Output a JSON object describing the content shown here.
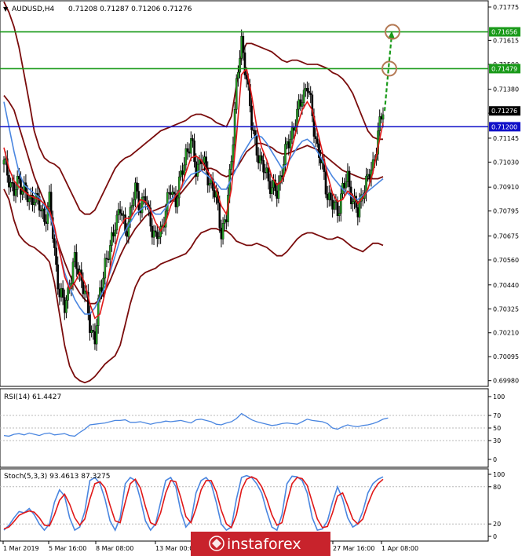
{
  "header": {
    "symbol": "AUDUSD,H4",
    "ohlc": "0.71208 0.71287 0.71206 0.71276"
  },
  "chart_data": [
    {
      "type": "candlestick",
      "ylim": [
        0.6996,
        0.7179
      ],
      "y_ticks": [
        "0.71775",
        "0.71615",
        "0.71500",
        "0.71380",
        "0.71265",
        "0.71145",
        "0.71030",
        "0.70910",
        "0.70795",
        "0.70675",
        "0.70560",
        "0.70440",
        "0.70325",
        "0.70210",
        "0.70095",
        "0.69980"
      ],
      "price_tags": [
        {
          "value": 0.71656,
          "label": "0.71656",
          "color": "#1a9a1a"
        },
        {
          "value": 0.71479,
          "label": "0.71479",
          "color": "#1a9a1a"
        },
        {
          "value": 0.71276,
          "label": "0.71276",
          "color": "#000000"
        },
        {
          "value": 0.712,
          "label": "0.71200",
          "color": "#1010c8"
        }
      ],
      "levels": [
        {
          "value": 0.71656,
          "color": "#1a9a1a"
        },
        {
          "value": 0.71479,
          "color": "#1a9a1a"
        },
        {
          "value": 0.712,
          "color": "#1010c8"
        }
      ],
      "close_path": [
        0.7102,
        0.7096,
        0.7088,
        0.7094,
        0.709,
        0.7083,
        0.7088,
        0.7081,
        0.7076,
        0.7084,
        0.706,
        0.704,
        0.7033,
        0.7045,
        0.7055,
        0.705,
        0.704,
        0.7025,
        0.7018,
        0.704,
        0.7055,
        0.706,
        0.7075,
        0.708,
        0.707,
        0.7078,
        0.709,
        0.7082,
        0.7085,
        0.7075,
        0.7065,
        0.707,
        0.708,
        0.709,
        0.7085,
        0.7095,
        0.7108,
        0.7112,
        0.71,
        0.7105,
        0.7098,
        0.7093,
        0.7085,
        0.707,
        0.7076,
        0.7105,
        0.714,
        0.716,
        0.7145,
        0.712,
        0.711,
        0.71,
        0.7098,
        0.709,
        0.7088,
        0.71,
        0.711,
        0.7118,
        0.7125,
        0.7135,
        0.714,
        0.7125,
        0.711,
        0.71,
        0.7088,
        0.7082,
        0.708,
        0.709,
        0.7095,
        0.7085,
        0.7078,
        0.709,
        0.7094,
        0.7102,
        0.7116,
        0.7128
      ],
      "ma_blue": [
        0.7132,
        0.712,
        0.7108,
        0.7098,
        0.7092,
        0.709,
        0.7088,
        0.7086,
        0.7082,
        0.7078,
        0.707,
        0.706,
        0.705,
        0.7043,
        0.7037,
        0.7033,
        0.703,
        0.703,
        0.7033,
        0.7038,
        0.7043,
        0.705,
        0.7058,
        0.7066,
        0.707,
        0.7074,
        0.7078,
        0.708,
        0.7082,
        0.708,
        0.7078,
        0.7078,
        0.7081,
        0.7085,
        0.7087,
        0.709,
        0.7094,
        0.7097,
        0.7098,
        0.7099,
        0.7097,
        0.7095,
        0.7093,
        0.709,
        0.709,
        0.7095,
        0.71,
        0.7106,
        0.711,
        0.7114,
        0.7116,
        0.7115,
        0.7112,
        0.7108,
        0.7104,
        0.71,
        0.7102,
        0.7106,
        0.711,
        0.7113,
        0.7114,
        0.7112,
        0.7108,
        0.7104,
        0.71,
        0.7096,
        0.7093,
        0.709,
        0.7088,
        0.7086,
        0.7085,
        0.7087,
        0.7089,
        0.7091,
        0.7093,
        0.7095
      ],
      "ma_red": [
        0.711,
        0.71,
        0.7094,
        0.7091,
        0.7089,
        0.7087,
        0.7086,
        0.7085,
        0.7083,
        0.708,
        0.7072,
        0.706,
        0.7048,
        0.7042,
        0.7045,
        0.705,
        0.7045,
        0.7035,
        0.7028,
        0.703,
        0.704,
        0.7052,
        0.7062,
        0.7072,
        0.7076,
        0.7076,
        0.708,
        0.7085,
        0.7084,
        0.708,
        0.7074,
        0.707,
        0.7074,
        0.7082,
        0.7087,
        0.709,
        0.7098,
        0.7105,
        0.7106,
        0.7104,
        0.71,
        0.7096,
        0.709,
        0.7082,
        0.7078,
        0.709,
        0.7115,
        0.7145,
        0.7148,
        0.7135,
        0.712,
        0.711,
        0.7104,
        0.7096,
        0.7092,
        0.7094,
        0.71,
        0.711,
        0.712,
        0.7128,
        0.7132,
        0.7128,
        0.7118,
        0.7108,
        0.7097,
        0.7088,
        0.7084,
        0.7085,
        0.7089,
        0.7087,
        0.7083,
        0.7086,
        0.709,
        0.7098,
        0.711,
        0.7122
      ],
      "bb_mid": [
        0.7135,
        0.7132,
        0.7128,
        0.712,
        0.7112,
        0.7104,
        0.7096,
        0.709,
        0.7084,
        0.7078,
        0.707,
        0.7062,
        0.7055,
        0.7049,
        0.7044,
        0.704,
        0.7037,
        0.7035,
        0.7035,
        0.7037,
        0.7041,
        0.7046,
        0.7052,
        0.7058,
        0.7063,
        0.7067,
        0.7071,
        0.7074,
        0.7077,
        0.7079,
        0.708,
        0.7081,
        0.7082,
        0.7084,
        0.7086,
        0.7088,
        0.7091,
        0.7094,
        0.7097,
        0.7099,
        0.71,
        0.71,
        0.7099,
        0.7097,
        0.7096,
        0.7097,
        0.71,
        0.7104,
        0.7108,
        0.711,
        0.7112,
        0.7112,
        0.7111,
        0.711,
        0.7108,
        0.7107,
        0.7107,
        0.7108,
        0.7109,
        0.711,
        0.7111,
        0.711,
        0.7109,
        0.7107,
        0.7105,
        0.7103,
        0.7101,
        0.7099,
        0.7098,
        0.7097,
        0.7096,
        0.7095,
        0.7095,
        0.7095,
        0.7095,
        0.7096
      ],
      "bb_upper": [
        0.718,
        0.7175,
        0.7168,
        0.7158,
        0.7145,
        0.7132,
        0.7118,
        0.711,
        0.7105,
        0.7103,
        0.7102,
        0.71,
        0.7095,
        0.709,
        0.7085,
        0.708,
        0.7078,
        0.7078,
        0.708,
        0.7085,
        0.709,
        0.7095,
        0.71,
        0.7103,
        0.7105,
        0.7106,
        0.7108,
        0.711,
        0.7112,
        0.7114,
        0.7116,
        0.7118,
        0.7119,
        0.712,
        0.7121,
        0.7122,
        0.7123,
        0.7125,
        0.7126,
        0.7126,
        0.7125,
        0.7124,
        0.7122,
        0.7121,
        0.712,
        0.7125,
        0.714,
        0.7155,
        0.716,
        0.716,
        0.7159,
        0.7158,
        0.7157,
        0.7156,
        0.7154,
        0.7152,
        0.7151,
        0.7152,
        0.7152,
        0.7151,
        0.715,
        0.715,
        0.715,
        0.7149,
        0.7148,
        0.7146,
        0.7145,
        0.7143,
        0.714,
        0.7136,
        0.713,
        0.7124,
        0.7118,
        0.7115,
        0.7114,
        0.7114
      ],
      "bb_lower": [
        0.709,
        0.7085,
        0.7075,
        0.7068,
        0.7065,
        0.7063,
        0.7062,
        0.706,
        0.7058,
        0.7055,
        0.7045,
        0.703,
        0.7015,
        0.7005,
        0.7,
        0.6998,
        0.6997,
        0.6998,
        0.7,
        0.7003,
        0.7006,
        0.7008,
        0.701,
        0.7015,
        0.7025,
        0.7035,
        0.7043,
        0.7048,
        0.705,
        0.7051,
        0.7052,
        0.7054,
        0.7055,
        0.7056,
        0.7057,
        0.7058,
        0.7059,
        0.7062,
        0.7066,
        0.7069,
        0.707,
        0.7071,
        0.7071,
        0.707,
        0.707,
        0.7068,
        0.7065,
        0.7064,
        0.7063,
        0.7063,
        0.7064,
        0.7063,
        0.7062,
        0.706,
        0.7058,
        0.7058,
        0.706,
        0.7063,
        0.7066,
        0.7068,
        0.7069,
        0.7069,
        0.7068,
        0.7067,
        0.7066,
        0.7066,
        0.7067,
        0.7066,
        0.7064,
        0.7062,
        0.7061,
        0.706,
        0.7062,
        0.7064,
        0.7064,
        0.7063
      ],
      "projection": {
        "from": 0.71276,
        "to": 0.71656,
        "color": "#1a9a1a",
        "targets": [
          0.71479,
          0.71656
        ],
        "circle_color": "#b47a55"
      }
    },
    {
      "type": "line",
      "title": "RSI(14) 61.4427",
      "ylim": [
        0,
        100
      ],
      "y_ticks": [
        "100",
        "70",
        "50",
        "30",
        "0"
      ],
      "levels": [
        70,
        50,
        30
      ],
      "values": [
        38,
        37,
        40,
        41,
        39,
        42,
        40,
        38,
        41,
        42,
        39,
        40,
        41,
        38,
        37,
        43,
        48,
        55,
        56,
        57,
        58,
        60,
        62,
        62,
        63,
        59,
        59,
        60,
        58,
        56,
        58,
        59,
        61,
        60,
        61,
        62,
        60,
        58,
        63,
        64,
        62,
        60,
        56,
        55,
        58,
        60,
        65,
        73,
        68,
        63,
        60,
        58,
        56,
        54,
        55,
        57,
        58,
        57,
        56,
        60,
        64,
        62,
        61,
        60,
        57,
        50,
        48,
        52,
        55,
        53,
        52,
        54,
        55,
        57,
        60,
        64,
        66
      ],
      "color": "#4a86e0"
    },
    {
      "type": "line",
      "title": "Stoch(5,3,3) 93.4613 87.3275",
      "ylim": [
        0,
        100
      ],
      "y_ticks": [
        "100",
        "80",
        "20",
        "0"
      ],
      "levels": [
        80,
        20
      ],
      "series": [
        {
          "values": [
            10,
            18,
            30,
            40,
            38,
            45,
            35,
            20,
            10,
            20,
            55,
            75,
            65,
            30,
            10,
            15,
            40,
            90,
            95,
            85,
            60,
            25,
            10,
            30,
            85,
            95,
            90,
            60,
            25,
            10,
            20,
            55,
            90,
            95,
            80,
            40,
            15,
            25,
            70,
            90,
            95,
            85,
            55,
            20,
            10,
            15,
            60,
            95,
            98,
            95,
            85,
            70,
            40,
            15,
            10,
            35,
            85,
            97,
            96,
            90,
            70,
            30,
            10,
            12,
            25,
            55,
            80,
            60,
            30,
            15,
            20,
            40,
            70,
            85,
            92,
            96
          ],
          "color": "#4a86e0"
        },
        {
          "values": [
            12,
            15,
            24,
            34,
            38,
            41,
            39,
            30,
            18,
            17,
            35,
            58,
            68,
            52,
            30,
            18,
            28,
            60,
            85,
            88,
            78,
            50,
            25,
            22,
            55,
            85,
            92,
            78,
            48,
            22,
            18,
            38,
            70,
            90,
            88,
            62,
            32,
            22,
            45,
            75,
            90,
            90,
            72,
            42,
            20,
            14,
            35,
            75,
            92,
            96,
            92,
            80,
            60,
            35,
            18,
            22,
            55,
            85,
            95,
            93,
            82,
            55,
            28,
            14,
            16,
            38,
            65,
            70,
            50,
            28,
            20,
            28,
            52,
            72,
            85,
            92
          ],
          "color": "#e01818"
        }
      ]
    }
  ],
  "x_labels": [
    "1 Mar 2019",
    "5 Mar 16:00",
    "8 Mar 08:00",
    "13 Mar 00:00",
    "27 Mar 16:00",
    "1 Apr 08:00"
  ],
  "watermark": "instaforex"
}
